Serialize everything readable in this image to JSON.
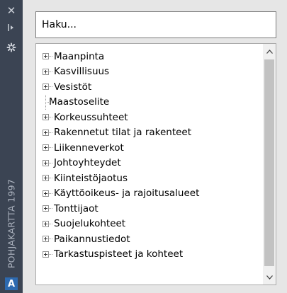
{
  "palette": {
    "title": "POHJAKARTTA 1997",
    "app_logo": "A",
    "icons": [
      "close-icon",
      "autohide-icon",
      "properties-icon",
      "autodesk-logo-icon"
    ]
  },
  "search": {
    "placeholder": "Haku..."
  },
  "tree": {
    "items": [
      {
        "label": "Maanpinta",
        "expandable": true
      },
      {
        "label": "Kasvillisuus",
        "expandable": true
      },
      {
        "label": "Vesistöt",
        "expandable": true
      },
      {
        "label": "Maastoselite",
        "expandable": false
      },
      {
        "label": "Korkeussuhteet",
        "expandable": true
      },
      {
        "label": "Rakennetut tilat ja rakenteet",
        "expandable": true
      },
      {
        "label": "Liikenneverkot",
        "expandable": true
      },
      {
        "label": "Johtoyhteydet",
        "expandable": true
      },
      {
        "label": "Kiinteistöjaotus",
        "expandable": true
      },
      {
        "label": "Käyttöoikeus- ja rajoitusalueet",
        "expandable": true
      },
      {
        "label": "Tonttijaot",
        "expandable": true
      },
      {
        "label": "Suojelukohteet",
        "expandable": true
      },
      {
        "label": "Paikannustiedot",
        "expandable": true
      },
      {
        "label": "Tarkastuspisteet ja kohteet",
        "expandable": true
      }
    ]
  },
  "colors": {
    "strip": "#3b4453",
    "panel": "#e6e6e6",
    "thumb": "#c2c2c2"
  }
}
